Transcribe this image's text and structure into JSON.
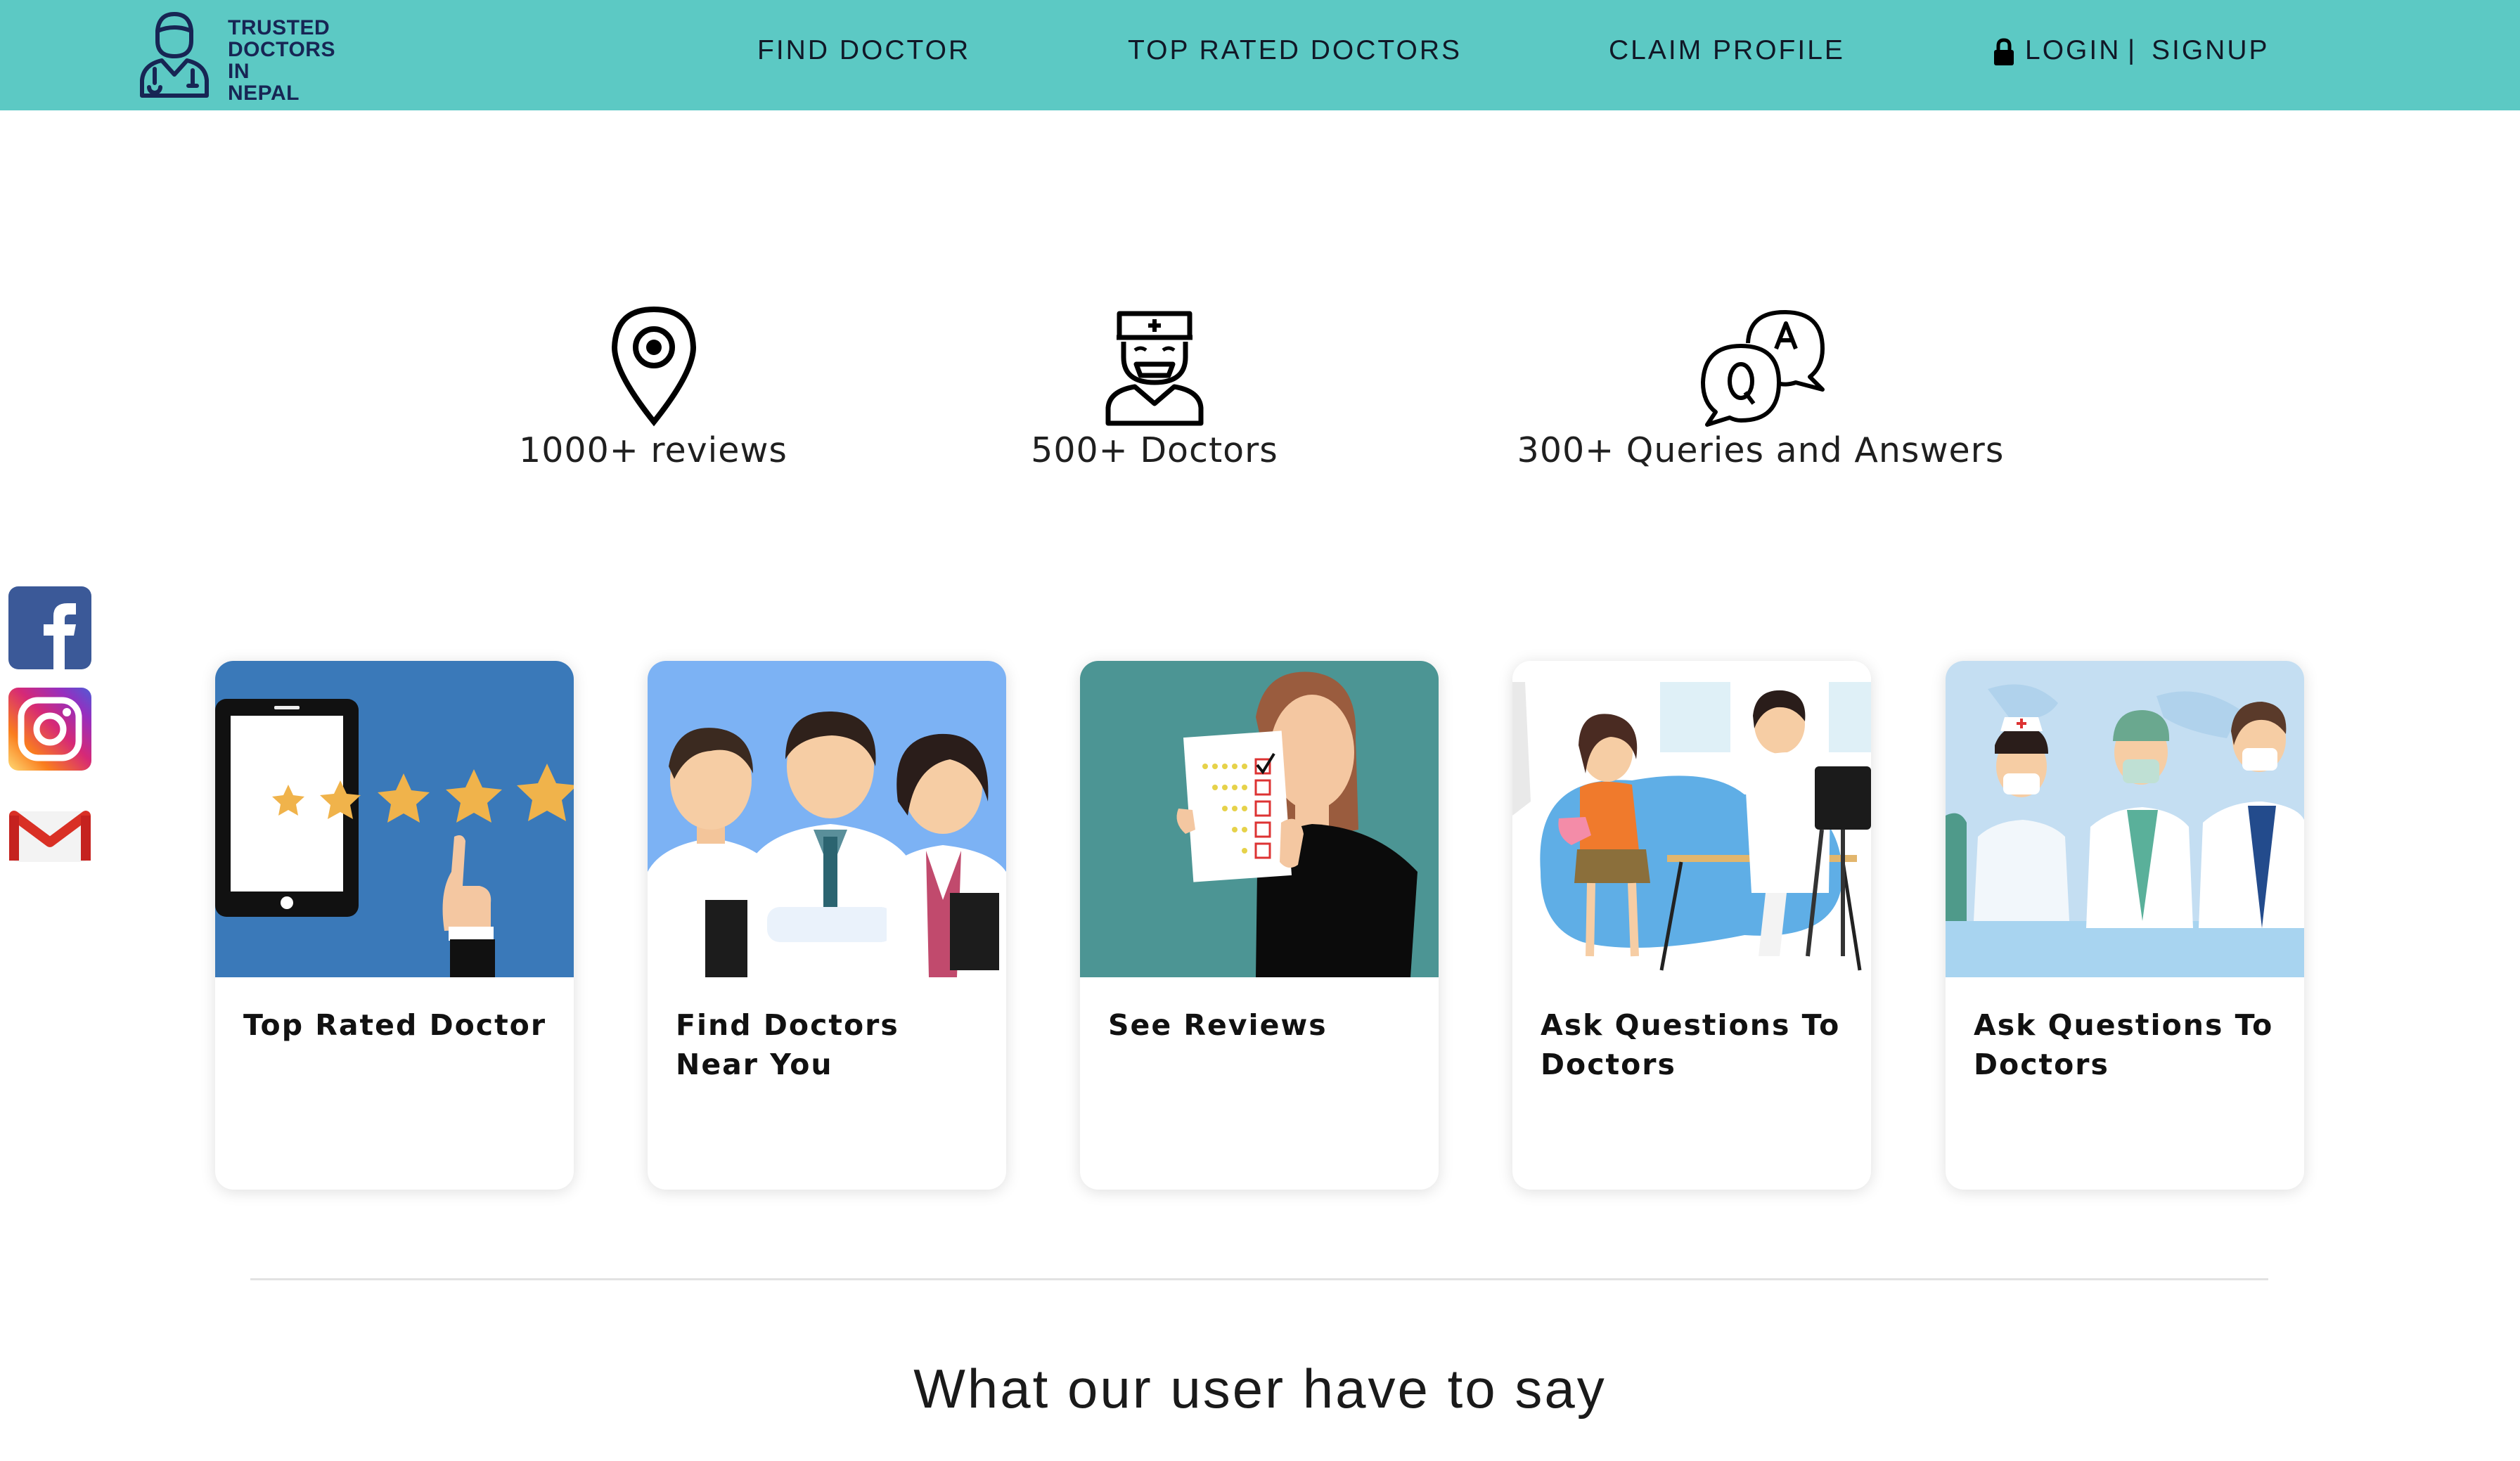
{
  "brand": {
    "logo_lines": [
      "TRUSTED",
      "DOCTORS",
      "IN",
      "NEPAL"
    ],
    "header_color": "#5cc9c4"
  },
  "nav": {
    "find_doctor": "FIND DOCTOR",
    "top_rated": "TOP RATED DOCTORS",
    "claim_profile": "CLAIM PROFILE",
    "login": "LOGIN",
    "separator": "|",
    "signup": "SIGNUP"
  },
  "stats": [
    {
      "icon": "location-pin-icon",
      "label": "1000+ reviews"
    },
    {
      "icon": "doctor-icon",
      "label": "500+ Doctors"
    },
    {
      "icon": "qa-bubbles-icon",
      "label": "300+ Queries and Answers"
    }
  ],
  "social": [
    {
      "icon": "facebook-icon",
      "color": "#3b5998"
    },
    {
      "icon": "instagram-icon",
      "color": "#dd2a7b"
    },
    {
      "icon": "gmail-icon",
      "color": "#d93025"
    }
  ],
  "cards": [
    {
      "title": "Top Rated Doctor",
      "image": "tablet-stars-illustration"
    },
    {
      "title": "Find Doctors Near You",
      "image": "doctors-group-illustration"
    },
    {
      "title": "See Reviews",
      "image": "review-checklist-illustration"
    },
    {
      "title": "Ask Questions To Doctors",
      "image": "patient-consultation-illustration"
    },
    {
      "title": "Ask Questions To Doctors",
      "image": "medical-staff-illustration"
    }
  ],
  "testimonials": {
    "heading": "What our user have to say"
  }
}
